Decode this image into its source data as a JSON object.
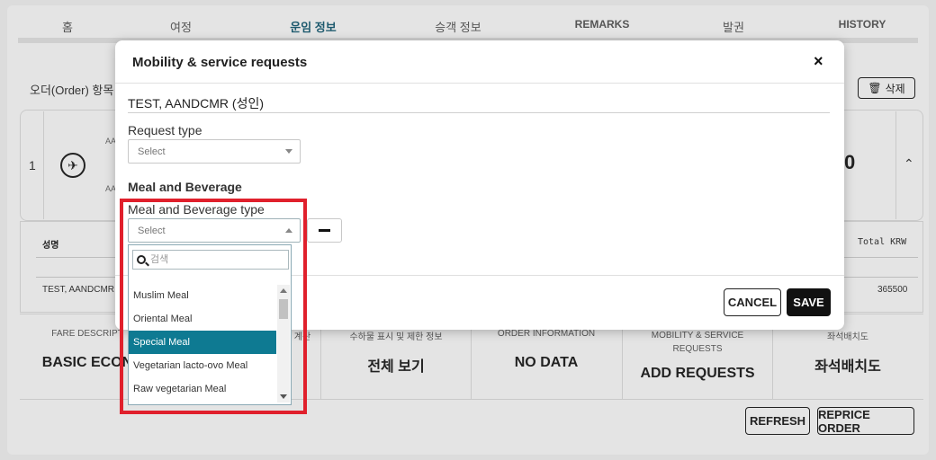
{
  "tabs": [
    "홈",
    "여정",
    "운임 정보",
    "승객 정보",
    "REMARKS",
    "발권",
    "HISTORY"
  ],
  "order_label": "오더(Order) 항목",
  "delete_label": "삭제",
  "card": {
    "index": "1",
    "code_top": "AA",
    "code_bottom": "AA",
    "amount_fragment": "0"
  },
  "pax_table": {
    "col_name": "성명",
    "col_total": "Total KRW",
    "row_name": "TEST, AANDCMR",
    "row_total": "365500"
  },
  "info_row": [
    {
      "label": "FARE DESCRIPT",
      "value": "BASIC ECON"
    },
    {
      "label": "계산",
      "value": ""
    },
    {
      "label": "수하물 표시 및 제한 정보",
      "value": "전체 보기"
    },
    {
      "label": "ORDER INFORMATION",
      "value": "NO DATA"
    },
    {
      "label": "MOBILITY & SERVICE REQUESTS",
      "value": "ADD REQUESTS"
    },
    {
      "label": "좌석배치도",
      "value": "좌석배치도"
    }
  ],
  "bottom_buttons": {
    "refresh": "REFRESH",
    "reprice": "REPRICE ORDER"
  },
  "modal": {
    "title": "Mobility & service requests",
    "close": "×",
    "passenger": "TEST, AANDCMR (성인)",
    "request_type_label": "Request type",
    "request_type_value": "Select",
    "section_label": "Meal and Beverage",
    "meal_type_label": "Meal and Beverage type",
    "meal_type_value": "Select",
    "cancel": "CANCEL",
    "save": "SAVE"
  },
  "dropdown": {
    "search_placeholder": "검색",
    "options": [
      "Muslim Meal",
      "Oriental Meal",
      "Special Meal",
      "Vegetarian lacto-ovo Meal",
      "Raw vegetarian Meal"
    ],
    "selected": "Special Meal"
  },
  "colors": {
    "accent": "#0e7a92",
    "highlight": "#e0202c",
    "primary_button": "#111111"
  }
}
